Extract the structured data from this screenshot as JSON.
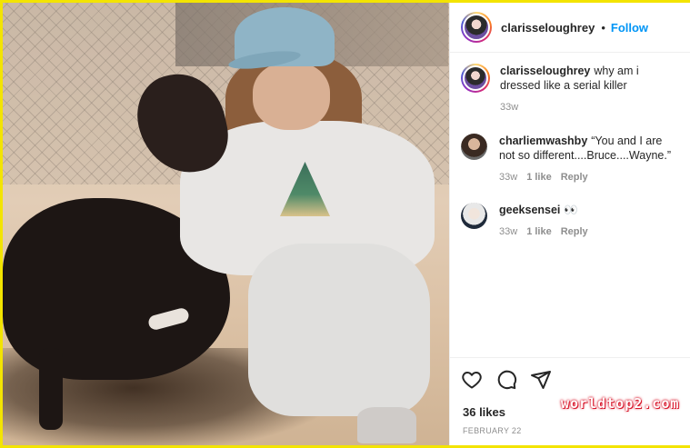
{
  "post": {
    "username": "clarisseloughrey",
    "separator": "•",
    "follow_label": "Follow"
  },
  "caption": {
    "username": "clarisseloughrey",
    "text": "why am i dressed like a serial killer",
    "age": "33w"
  },
  "comments": [
    {
      "username": "charliemwashby",
      "text": "“You and I are not so different....Bruce....Wayne.”",
      "age": "33w",
      "likes": "1 like",
      "reply_label": "Reply"
    },
    {
      "username": "geeksensei",
      "text": "👀",
      "age": "33w",
      "likes": "1 like",
      "reply_label": "Reply"
    }
  ],
  "footer": {
    "likes": "36 likes",
    "date": "FEBRUARY 22"
  },
  "watermark": "worldtop2.com",
  "icons": [
    "heart-icon",
    "comment-icon",
    "share-icon"
  ],
  "colors": {
    "follow": "#0095f6",
    "frame": "#f3e400",
    "watermark_glow": "#d8182c"
  }
}
